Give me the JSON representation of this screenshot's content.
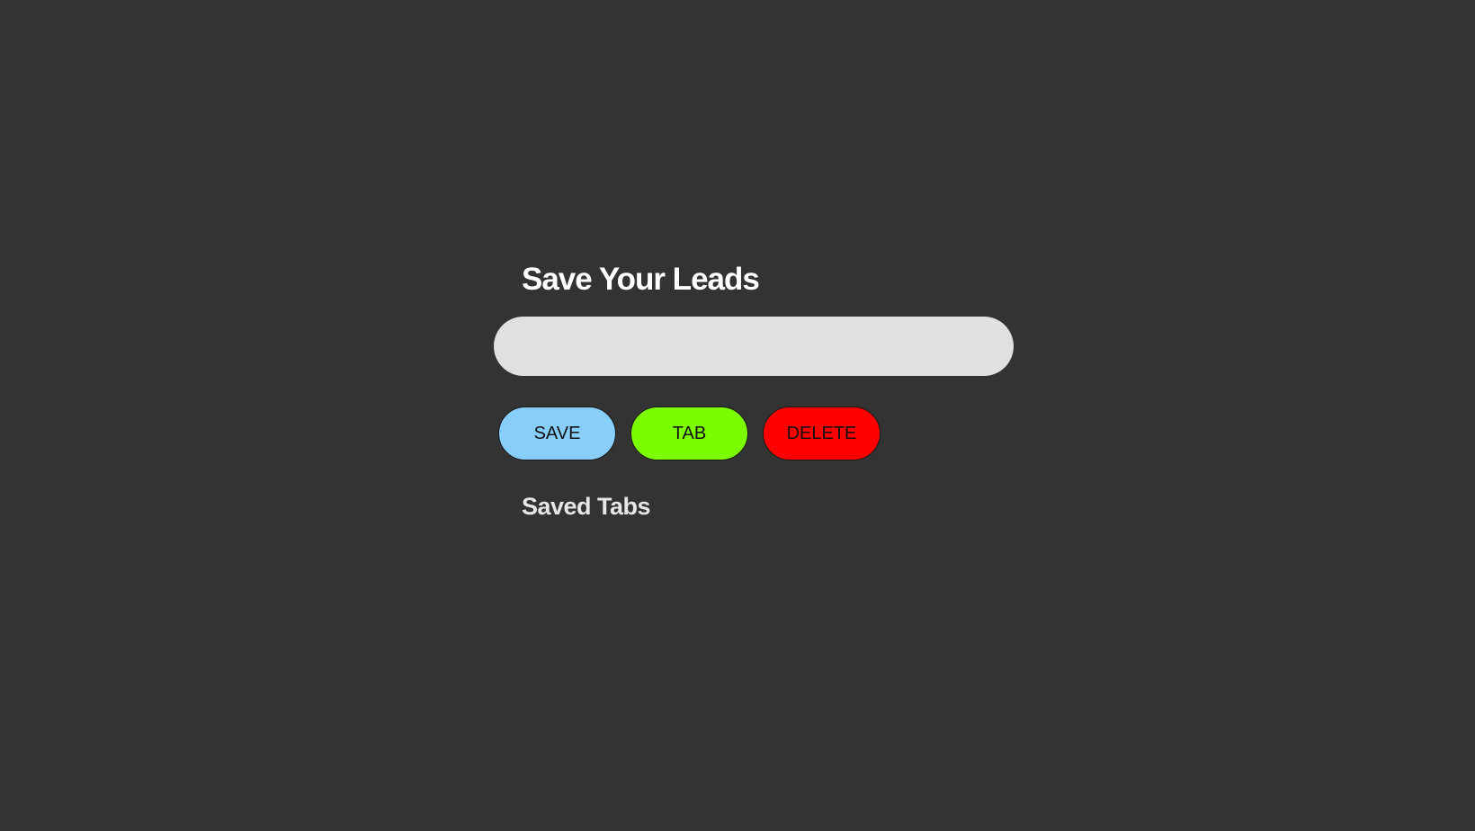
{
  "header": {
    "title": "Save Your Leads"
  },
  "input": {
    "value": "",
    "placeholder": ""
  },
  "buttons": {
    "save_label": "SAVE",
    "tab_label": "TAB",
    "delete_label": "DELETE"
  },
  "saved": {
    "heading": "Saved Tabs",
    "items": []
  },
  "colors": {
    "background": "#333333",
    "input_bg": "#e0e0e0",
    "save": "#87cefa",
    "tab": "#7cfc00",
    "delete": "#ff0000"
  }
}
